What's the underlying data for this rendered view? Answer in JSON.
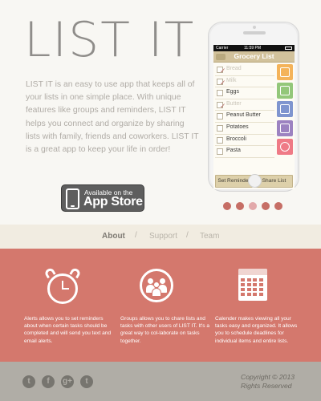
{
  "hero": {
    "logo": "LIST IT",
    "description": "LIST IT is an easy to use app that keeps all of your lists in one simple place. With unique features like groups and reminders, LIST IT helps you connect and organize by sharing lists with family, friends and coworkers. LIST IT is a great app to keep your life in order!",
    "app_store": {
      "small": "Available on the",
      "big": "App Store",
      "icon": "phone-icon"
    }
  },
  "phone": {
    "status_carrier": "Carrier",
    "status_time": "11:59 PM",
    "title": "Grocery List",
    "items": [
      {
        "label": "Bread",
        "checked": true
      },
      {
        "label": "Milk",
        "checked": true
      },
      {
        "label": "Eggs",
        "checked": false
      },
      {
        "label": "Butter",
        "checked": true
      },
      {
        "label": "Peanut Butter",
        "checked": false
      },
      {
        "label": "Potatoes",
        "checked": false
      },
      {
        "label": "Broccoli",
        "checked": false
      },
      {
        "label": "Pasta",
        "checked": false
      }
    ],
    "side_icons": [
      {
        "name": "list-icon",
        "color": "#f4b35a"
      },
      {
        "name": "document-icon",
        "color": "#93c77a"
      },
      {
        "name": "copy-icon",
        "color": "#7f95cf"
      },
      {
        "name": "group-icon",
        "color": "#9c82c1"
      },
      {
        "name": "gear-icon",
        "color": "#ef7a86"
      }
    ],
    "buttons": {
      "reminder": "Set Reminder",
      "share": "Share List"
    }
  },
  "carousel": {
    "active_index": 2,
    "colors": [
      "#c66e65",
      "#c66e65",
      "#e2a9aa",
      "#c66e65",
      "#c66e65"
    ]
  },
  "nav": {
    "items": [
      {
        "label": "About",
        "active": true
      },
      {
        "label": "Support",
        "active": false
      },
      {
        "label": "Team",
        "active": false
      }
    ],
    "separator": "/",
    "active_color": "#7e7a73",
    "inactive_color": "#b9b4aa"
  },
  "features": {
    "accent": "#d4786d",
    "items": [
      {
        "icon": "alarm-clock-icon",
        "text": "Alerts allows you to set reminders about when certain tasks should be completed and will send you text and email alerts."
      },
      {
        "icon": "group-icon",
        "text": "Groups allows you to chare lists and tasks with other users of LIST IT. It's a great way to col-laborate on tasks together."
      },
      {
        "icon": "calendar-icon",
        "text": "Calender makes viewing all your tasks easy and organized. It allows you to schedule deadlines for individual items and entire lists."
      }
    ]
  },
  "footer": {
    "social": [
      {
        "name": "twitter-icon",
        "glyph": "t"
      },
      {
        "name": "facebook-icon",
        "glyph": "f"
      },
      {
        "name": "googleplus-icon",
        "glyph": "g+"
      },
      {
        "name": "tumblr-icon",
        "glyph": "t"
      }
    ],
    "copyright_line1": "Copyright © 2013",
    "copyright_line2": "Rights Reserved"
  }
}
